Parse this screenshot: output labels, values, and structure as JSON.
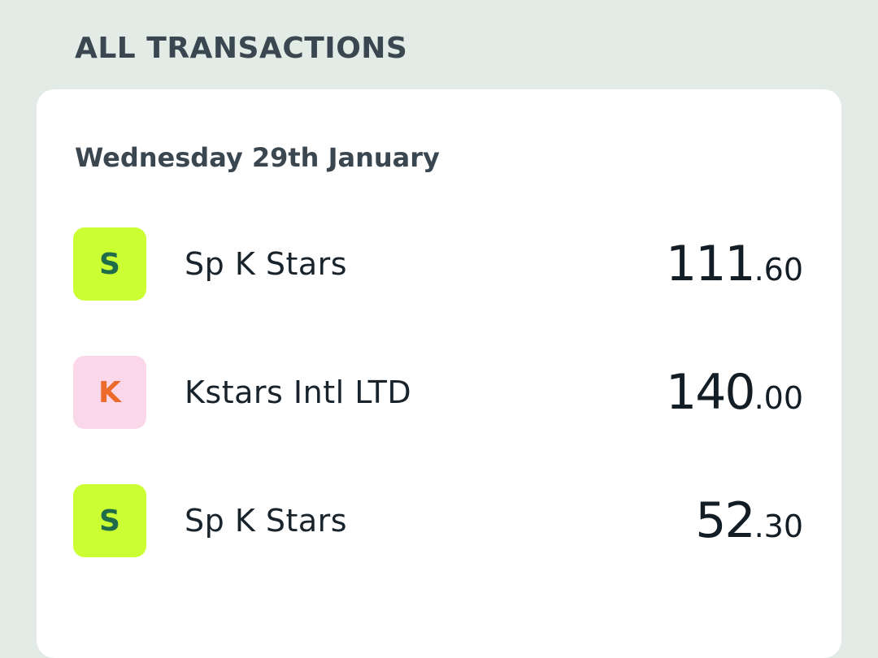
{
  "section_title": "ALL TRANSACTIONS",
  "date_header": "Wednesday 29th January",
  "transactions": [
    {
      "initial": "S",
      "merchant": "Sp K Stars",
      "amount_major": "111",
      "amount_minor": ".60",
      "avatar_bg": "#ccff33",
      "avatar_fg": "#1f6b4a"
    },
    {
      "initial": "K",
      "merchant": "Kstars Intl LTD",
      "amount_major": "140",
      "amount_minor": ".00",
      "avatar_bg": "#fbd7ea",
      "avatar_fg": "#ec6a2a"
    },
    {
      "initial": "S",
      "merchant": "Sp K Stars",
      "amount_major": "52",
      "amount_minor": ".30",
      "avatar_bg": "#ccff33",
      "avatar_fg": "#1f6b4a"
    }
  ]
}
